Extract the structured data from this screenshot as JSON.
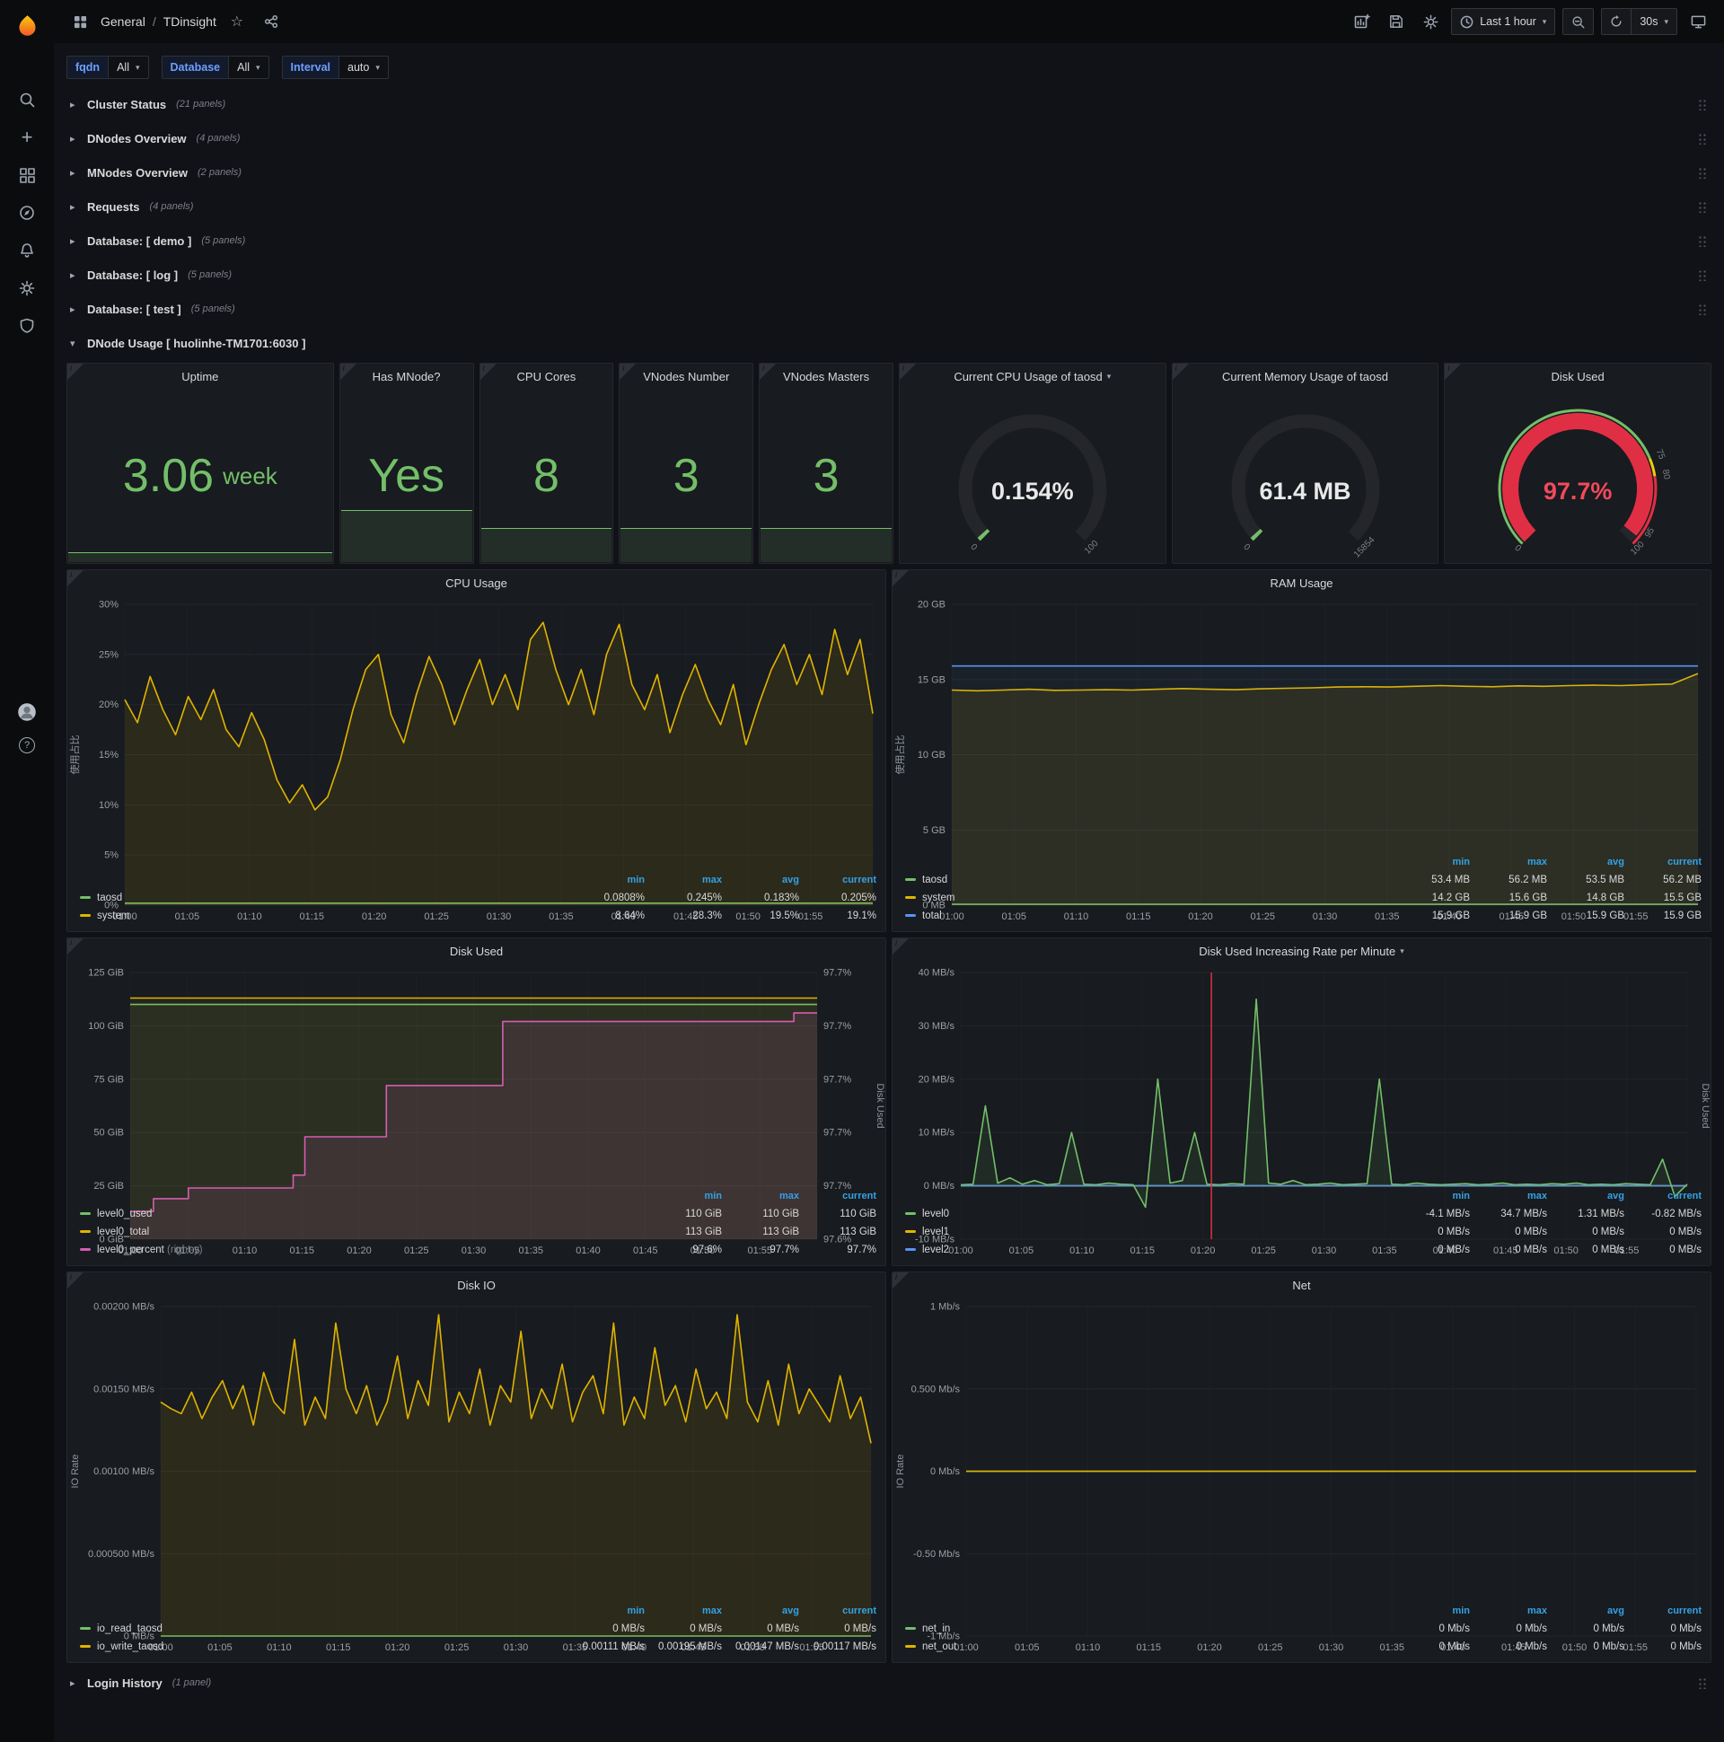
{
  "icons": {
    "info": "i",
    "caret": "▾",
    "chevron_right": "▸",
    "chevron_down": "▾",
    "star": "☆",
    "plus": "+",
    "question": "?"
  },
  "nav": {
    "section": "General",
    "separator": "/",
    "page": "TDinsight",
    "time_range": "Last 1 hour",
    "refresh": "30s"
  },
  "variables": {
    "v1_label": "fqdn",
    "v1_value": "All",
    "v2_label": "Database",
    "v2_value": "All",
    "v3_label": "Interval",
    "v3_value": "auto"
  },
  "rows": [
    {
      "title": "Cluster Status",
      "count": "(21 panels)"
    },
    {
      "title": "DNodes Overview",
      "count": "(4 panels)"
    },
    {
      "title": "MNodes Overview",
      "count": "(2 panels)"
    },
    {
      "title": "Requests",
      "count": "(4 panels)"
    },
    {
      "title": "Database: [ demo ]",
      "count": "(5 panels)"
    },
    {
      "title": "Database: [ log ]",
      "count": "(5 panels)"
    },
    {
      "title": "Database: [ test ]",
      "count": "(5 panels)"
    }
  ],
  "dnode_row": {
    "title": "DNode Usage [ huolinhe-TM1701:6030 ]"
  },
  "login_row": {
    "title": "Login History",
    "count": "(1 panel)"
  },
  "stats": {
    "uptime": {
      "title": "Uptime",
      "value": "3.06",
      "unit": "week",
      "spark": 5
    },
    "has_mnode": {
      "title": "Has MNode?",
      "value": "Yes",
      "spark": 26
    },
    "cpu_cores": {
      "title": "CPU Cores",
      "value": "8",
      "spark": 17
    },
    "vnodes_number": {
      "title": "VNodes Number",
      "value": "3",
      "spark": 17
    },
    "vnodes_masters": {
      "title": "VNodes Masters",
      "value": "3",
      "spark": 17
    },
    "cpu_gauge": {
      "title": "Current CPU Usage of taosd",
      "value": "0.154%",
      "fraction": 0.00154,
      "color": "#73bf69",
      "thick": 15,
      "labels": [
        {
          "text": "0",
          "f": 0
        },
        {
          "text": "100",
          "f": 1
        }
      ]
    },
    "mem_gauge": {
      "title": "Current Memory Usage of taosd",
      "value": "61.4 MB",
      "fraction": 0.004,
      "color": "#73bf69",
      "thick": 15,
      "labels": [
        {
          "text": "0",
          "f": 0
        },
        {
          "text": "15854",
          "f": 1
        }
      ]
    },
    "disk_gauge": {
      "title": "Disk Used",
      "value": "97.7%",
      "fraction": 0.977,
      "color": "#e02f44",
      "value_color": "#f2495c",
      "thick": 18,
      "thresholds": [
        {
          "f0": 0,
          "f1": 0.75,
          "color": "#73bf69"
        },
        {
          "f0": 0.75,
          "f1": 0.8,
          "color": "#f2cc0c"
        },
        {
          "f0": 0.8,
          "f1": 1,
          "color": "#e02f44"
        }
      ],
      "labels": [
        {
          "text": "0",
          "f": 0
        },
        {
          "text": "75",
          "f": 0.75
        },
        {
          "text": "80",
          "f": 0.8
        },
        {
          "text": "95",
          "f": 0.95
        },
        {
          "text": "100",
          "f": 1
        }
      ]
    }
  },
  "charts": {
    "cpu": {
      "type": "line",
      "title": "CPU Usage",
      "ylabel": "使用占比",
      "ylabels": [
        "0%",
        "5%",
        "10%",
        "15%",
        "20%",
        "25%",
        "30%"
      ],
      "ymin": 0,
      "ymax": 30,
      "xlabels": [
        "01:00",
        "01:05",
        "01:10",
        "01:15",
        "01:20",
        "01:25",
        "01:30",
        "01:35",
        "01:40",
        "01:45",
        "01:50",
        "01:55"
      ],
      "series": [
        {
          "name": "taosd",
          "color": "#73bf69",
          "fill": 0.1,
          "data": [
            0.2,
            0.2
          ]
        },
        {
          "name": "system",
          "color": "#e0b400",
          "fill": 0.1,
          "data": [
            20.5,
            18.2,
            22.8,
            19.5,
            17.0,
            20.8,
            18.5,
            21.5,
            17.5,
            15.8,
            19.2,
            16.5,
            12.5,
            10.2,
            12.0,
            9.5,
            10.8,
            14.5,
            19.5,
            23.5,
            25.0,
            19.0,
            16.2,
            21.0,
            24.8,
            22.0,
            18.0,
            21.5,
            24.5,
            20.0,
            23.0,
            19.5,
            26.5,
            28.2,
            23.5,
            20.0,
            23.5,
            19.0,
            25.0,
            28.0,
            22.0,
            19.5,
            23.0,
            17.2,
            21.0,
            24.0,
            20.5,
            18.0,
            22.0,
            16.0,
            20.0,
            23.5,
            26.0,
            22.0,
            25.0,
            21.0,
            27.5,
            23.0,
            26.5,
            19.1
          ]
        }
      ],
      "legend": {
        "columns": [
          "min",
          "max",
          "avg",
          "current"
        ],
        "rows": [
          {
            "name": "taosd",
            "color": "#73bf69",
            "values": [
              "0.0808%",
              "0.245%",
              "0.183%",
              "0.205%"
            ]
          },
          {
            "name": "system",
            "color": "#e0b400",
            "values": [
              "8.64%",
              "28.3%",
              "19.5%",
              "19.1%"
            ]
          }
        ]
      }
    },
    "ram": {
      "type": "line",
      "title": "RAM Usage",
      "ylabel": "使用占比",
      "ylabels": [
        "0 MB",
        "5 GB",
        "10 GB",
        "15 GB",
        "20 GB"
      ],
      "ymin": 0,
      "ymax": 20,
      "xlabels": [
        "01:00",
        "01:05",
        "01:10",
        "01:15",
        "01:20",
        "01:25",
        "01:30",
        "01:35",
        "01:40",
        "01:45",
        "01:50",
        "01:55"
      ],
      "series": [
        {
          "name": "taosd",
          "color": "#73bf69",
          "fill": 0.08,
          "data": [
            0.055,
            0.055
          ]
        },
        {
          "name": "system",
          "color": "#e0b400",
          "fill": 0.1,
          "data": [
            14.3,
            14.25,
            14.3,
            14.35,
            14.28,
            14.3,
            14.32,
            14.3,
            14.35,
            14.4,
            14.35,
            14.32,
            14.38,
            14.42,
            14.45,
            14.5,
            14.52,
            14.5,
            14.55,
            14.6,
            14.55,
            14.52,
            14.58,
            14.55,
            14.6,
            14.62,
            14.6,
            14.65,
            14.7,
            15.4
          ]
        },
        {
          "name": "total",
          "color": "#5794f2",
          "fill": 0.05,
          "data": [
            15.9,
            15.9
          ]
        }
      ],
      "legend": {
        "columns": [
          "min",
          "max",
          "avg",
          "current"
        ],
        "rows": [
          {
            "name": "taosd",
            "color": "#73bf69",
            "values": [
              "53.4 MB",
              "56.2 MB",
              "53.5 MB",
              "56.2 MB"
            ]
          },
          {
            "name": "system",
            "color": "#e0b400",
            "values": [
              "14.2 GB",
              "15.6 GB",
              "14.8 GB",
              "15.5 GB"
            ]
          },
          {
            "name": "total",
            "color": "#5794f2",
            "values": [
              "15.9 GB",
              "15.9 GB",
              "15.9 GB",
              "15.9 GB"
            ]
          }
        ]
      }
    },
    "disk": {
      "type": "line",
      "title": "Disk Used",
      "ylabel_right": "Disk Used",
      "ylabels": [
        "0 GiB",
        "25 GiB",
        "50 GiB",
        "75 GiB",
        "100 GiB",
        "125 GiB"
      ],
      "ymin": 0,
      "ymax": 125,
      "ylabels_right": [
        "97.6%",
        "97.7%",
        "97.7%",
        "97.7%",
        "97.7%",
        "97.7%"
      ],
      "right_min": 97.588,
      "right_max": 97.713,
      "xlabels": [
        "01:00",
        "01:05",
        "01:10",
        "01:15",
        "01:20",
        "01:25",
        "01:30",
        "01:35",
        "01:40",
        "01:45",
        "01:50",
        "01:55"
      ],
      "series": [
        {
          "name": "level0_used",
          "color": "#73bf69",
          "fill": 0.08,
          "data": [
            110,
            110
          ]
        },
        {
          "name": "level0_total",
          "color": "#e0b400",
          "fill": 0.06,
          "data": [
            113,
            113
          ]
        },
        {
          "name": "level0_percent",
          "color": "#d65db1",
          "fill": 0.12,
          "step": true,
          "axis": "right",
          "data": [
            97.601,
            97.601,
            97.607,
            97.607,
            97.607,
            97.612,
            97.612,
            97.612,
            97.612,
            97.612,
            97.612,
            97.612,
            97.612,
            97.612,
            97.618,
            97.636,
            97.636,
            97.636,
            97.636,
            97.636,
            97.636,
            97.636,
            97.66,
            97.66,
            97.66,
            97.66,
            97.66,
            97.66,
            97.66,
            97.66,
            97.66,
            97.66,
            97.69,
            97.69,
            97.69,
            97.69,
            97.69,
            97.69,
            97.69,
            97.69,
            97.69,
            97.69,
            97.69,
            97.69,
            97.69,
            97.69,
            97.69,
            97.69,
            97.69,
            97.69,
            97.69,
            97.69,
            97.69,
            97.69,
            97.69,
            97.69,
            97.69,
            97.694,
            97.694,
            97.694
          ]
        }
      ],
      "legend": {
        "columns": [
          "min",
          "max",
          "current"
        ],
        "rows": [
          {
            "name": "level0_used",
            "color": "#73bf69",
            "values": [
              "110 GiB",
              "110 GiB",
              "110 GiB"
            ]
          },
          {
            "name": "level0_total",
            "color": "#e0b400",
            "values": [
              "113 GiB",
              "113 GiB",
              "113 GiB"
            ]
          },
          {
            "name": "level0_percent",
            "color": "#d65db1",
            "note": "(right-y)",
            "values": [
              "97.6%",
              "97.7%",
              "97.7%"
            ]
          }
        ]
      }
    },
    "rate": {
      "type": "line",
      "title": "Disk Used Increasing Rate per Minute",
      "ylabel_right": "Disk Used",
      "ylabels": [
        "-10 MB/s",
        "0 MB/s",
        "10 MB/s",
        "20 MB/s",
        "30 MB/s",
        "40 MB/s"
      ],
      "ymin": -10,
      "ymax": 40,
      "xlabels": [
        "01:00",
        "01:05",
        "01:10",
        "01:15",
        "01:20",
        "01:25",
        "01:30",
        "01:35",
        "01:40",
        "01:45",
        "01:50",
        "01:55"
      ],
      "vline": 0.345,
      "vline_color": "#e02f44",
      "series": [
        {
          "name": "level1",
          "color": "#e0b400",
          "data": [
            0,
            0
          ]
        },
        {
          "name": "level2",
          "color": "#5794f2",
          "data": [
            0,
            0
          ]
        },
        {
          "name": "level0",
          "color": "#73bf69",
          "fill": 0.1,
          "data": [
            0.2,
            0.3,
            15,
            0.5,
            1.5,
            0.3,
            1.0,
            0.2,
            0.4,
            10,
            0.3,
            0.2,
            0.5,
            0.3,
            0.2,
            -4,
            20,
            0.5,
            1.0,
            10,
            0.3,
            0.2,
            0.4,
            0.3,
            35,
            0.5,
            0.3,
            1.0,
            0.2,
            0.3,
            0.5,
            0.2,
            0.3,
            0.4,
            20,
            0.3,
            0.2,
            0.5,
            0.3,
            0.2,
            0.3,
            0.4,
            0.2,
            0.3,
            0.5,
            0.2,
            0.3,
            0.2,
            0.4,
            0.3,
            0.5,
            0.2,
            0.3,
            0.2,
            0.4,
            0.3,
            0.2,
            5,
            -2,
            0.3
          ]
        }
      ],
      "legend": {
        "columns": [
          "min",
          "max",
          "avg",
          "current"
        ],
        "rows": [
          {
            "name": "level0",
            "color": "#73bf69",
            "values": [
              "-4.1 MB/s",
              "34.7 MB/s",
              "1.31 MB/s",
              "-0.82 MB/s"
            ]
          },
          {
            "name": "level1",
            "color": "#e0b400",
            "values": [
              "0 MB/s",
              "0 MB/s",
              "0 MB/s",
              "0 MB/s"
            ]
          },
          {
            "name": "level2",
            "color": "#5794f2",
            "values": [
              "0 MB/s",
              "0 MB/s",
              "0 MB/s",
              "0 MB/s"
            ]
          }
        ]
      }
    },
    "diskio": {
      "type": "line",
      "title": "Disk IO",
      "ylabel": "IO Rate",
      "ylabels": [
        "0 MB/s",
        "0.000500 MB/s",
        "0.00100 MB/s",
        "0.00150 MB/s",
        "0.00200 MB/s"
      ],
      "ymin": 0,
      "ymax": 0.002,
      "xlabels": [
        "01:00",
        "01:05",
        "01:10",
        "01:15",
        "01:20",
        "01:25",
        "01:30",
        "01:35",
        "01:40",
        "01:45",
        "01:50",
        "01:55"
      ],
      "series": [
        {
          "name": "io_read_taosd",
          "color": "#73bf69",
          "fill": 0.08,
          "data": [
            0,
            0
          ]
        },
        {
          "name": "io_write_taosd",
          "color": "#e0b400",
          "fill": 0.1,
          "data": [
            0.00142,
            0.00138,
            0.00135,
            0.00148,
            0.00132,
            0.00145,
            0.00155,
            0.00138,
            0.00152,
            0.00128,
            0.0016,
            0.00142,
            0.00135,
            0.0018,
            0.00128,
            0.00145,
            0.00132,
            0.0019,
            0.0015,
            0.00135,
            0.00152,
            0.00128,
            0.00142,
            0.0017,
            0.00132,
            0.00155,
            0.0014,
            0.00195,
            0.0013,
            0.00148,
            0.00135,
            0.00162,
            0.00128,
            0.00152,
            0.00142,
            0.00185,
            0.00132,
            0.0015,
            0.00138,
            0.00165,
            0.0013,
            0.00148,
            0.00158,
            0.00135,
            0.0019,
            0.00128,
            0.00145,
            0.00132,
            0.00175,
            0.0014,
            0.00152,
            0.0013,
            0.00162,
            0.00138,
            0.00148,
            0.00132,
            0.00195,
            0.00142,
            0.0013,
            0.00155,
            0.00128,
            0.00165,
            0.00135,
            0.0015,
            0.0014,
            0.0013,
            0.00158,
            0.00132,
            0.00145,
            0.00117
          ]
        }
      ],
      "legend": {
        "columns": [
          "min",
          "max",
          "avg",
          "current"
        ],
        "rows": [
          {
            "name": "io_read_taosd",
            "color": "#73bf69",
            "values": [
              "0 MB/s",
              "0 MB/s",
              "0 MB/s",
              "0 MB/s"
            ]
          },
          {
            "name": "io_write_taosd",
            "color": "#e0b400",
            "values": [
              "0.00111 MB/s",
              "0.00195 MB/s",
              "0.00147 MB/s",
              "0.00117 MB/s"
            ]
          }
        ]
      }
    },
    "net": {
      "type": "line",
      "title": "Net",
      "ylabel": "IO Rate",
      "ylabels": [
        "-1 Mb/s",
        "-0.50 Mb/s",
        "0 Mb/s",
        "0.500 Mb/s",
        "1 Mb/s"
      ],
      "ymin": -1,
      "ymax": 1,
      "xlabels": [
        "01:00",
        "01:05",
        "01:10",
        "01:15",
        "01:20",
        "01:25",
        "01:30",
        "01:35",
        "01:40",
        "01:45",
        "01:50",
        "01:55"
      ],
      "series": [
        {
          "name": "net_in",
          "color": "#73bf69",
          "data": [
            0,
            0
          ]
        },
        {
          "name": "net_out",
          "color": "#e0b400",
          "data": [
            0,
            0
          ]
        }
      ],
      "legend": {
        "columns": [
          "min",
          "max",
          "avg",
          "current"
        ],
        "rows": [
          {
            "name": "net_in",
            "color": "#73bf69",
            "values": [
              "0 Mb/s",
              "0 Mb/s",
              "0 Mb/s",
              "0 Mb/s"
            ]
          },
          {
            "name": "net_out",
            "color": "#e0b400",
            "values": [
              "0 Mb/s",
              "0 Mb/s",
              "0 Mb/s",
              "0 Mb/s"
            ]
          }
        ]
      }
    }
  }
}
